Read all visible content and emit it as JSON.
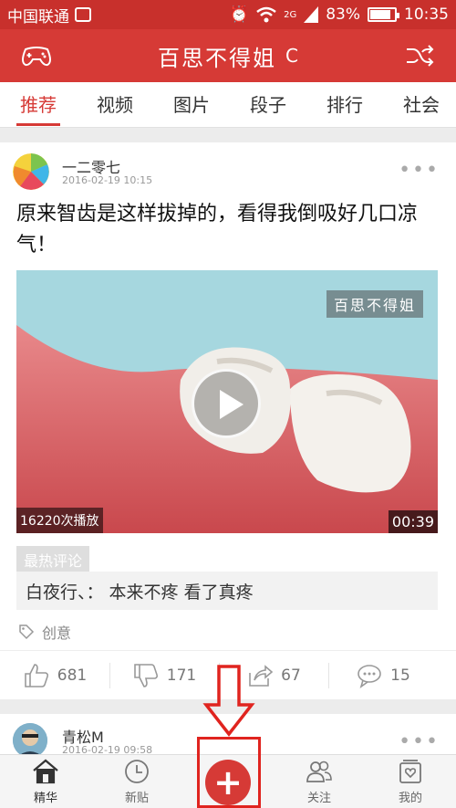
{
  "status_bar": {
    "carrier": "中国联通",
    "network": "2G",
    "battery": "83%",
    "battery_level": 0.83,
    "time": "10:35"
  },
  "app": {
    "title": "百思不得姐",
    "refresh_glyph": "C"
  },
  "tabs": [
    {
      "label": "推荐",
      "active": true
    },
    {
      "label": "视频",
      "active": false
    },
    {
      "label": "图片",
      "active": false
    },
    {
      "label": "段子",
      "active": false
    },
    {
      "label": "排行",
      "active": false
    },
    {
      "label": "社会",
      "active": false
    }
  ],
  "post": {
    "author": "一二零七",
    "time": "2016-02-19 10:15",
    "more": "•••",
    "title": "原来智齿是这样拔掉的，看得我倒吸好几口凉气！",
    "video": {
      "watermark": "百思不得姐",
      "play_count": "16220次播放",
      "duration": "00:39"
    },
    "hot_label": "最热评论",
    "top_comment": "白夜行、：  本来不疼  看了真疼",
    "tag": "创意",
    "actions": {
      "like": "681",
      "dislike": "171",
      "share": "67",
      "comment": "15"
    }
  },
  "post2": {
    "author": "青松M",
    "time": "2016-02-19 09:58",
    "more": "•••"
  },
  "bottom_nav": [
    {
      "label": "精华",
      "icon": "house-icon",
      "active": true
    },
    {
      "label": "新贴",
      "icon": "clock-icon",
      "active": false
    },
    {
      "label": "",
      "icon": "plus-icon",
      "active": false
    },
    {
      "label": "关注",
      "icon": "people-icon",
      "active": false
    },
    {
      "label": "我的",
      "icon": "profile-icon",
      "active": false
    }
  ],
  "colors": {
    "brand": "#d63a36",
    "annotation": "#e0241f"
  }
}
